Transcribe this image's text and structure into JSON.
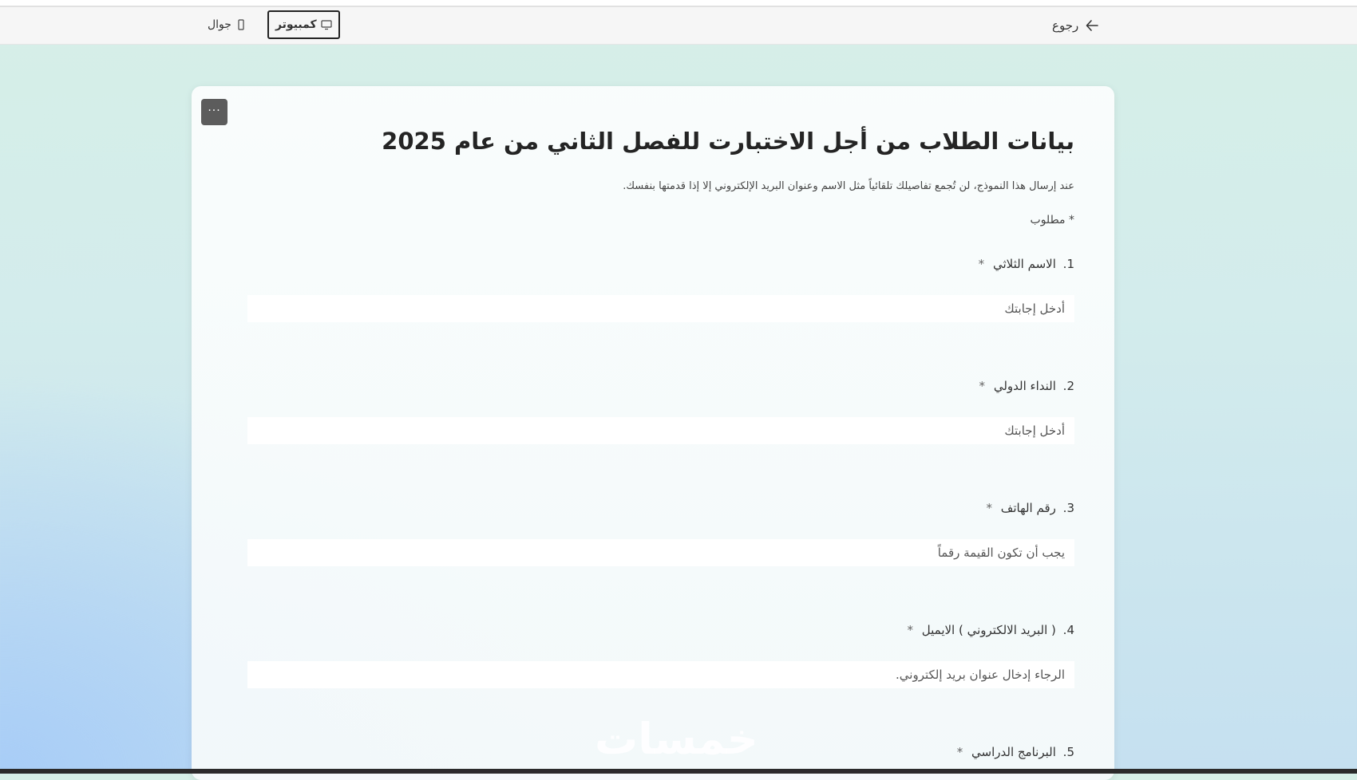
{
  "header": {
    "back_label": "رجوع",
    "view_desktop": "كمبيوتر",
    "view_mobile": "جوال"
  },
  "form": {
    "more_label": "···",
    "title": "بيانات الطلاب من أجل الاختبارت للفصل الثاني من عام 2025",
    "description": "عند إرسال هذا النموذج، لن تُجمع تفاصيلك تلقائياً مثل الاسم وعنوان البريد الإلكتروني إلا إذا قدمتها بنفسك.",
    "required_note": "* مطلوب",
    "questions": [
      {
        "number": "1.",
        "label": "الاسم الثلاثي",
        "required": "*",
        "placeholder": "أدخل إجابتك"
      },
      {
        "number": "2.",
        "label": "النداء الدولي",
        "required": "*",
        "placeholder": "أدخل إجابتك"
      },
      {
        "number": "3.",
        "label": "رقم الهاتف",
        "required": "*",
        "placeholder": "يجب أن تكون القيمة رقماً"
      },
      {
        "number": "4.",
        "label": "( البريد الالكتروني ) الايميل",
        "required": "*",
        "placeholder": "الرجاء إدخال عنوان بريد إلكتروني."
      },
      {
        "number": "5.",
        "label": "البرنامج الدراسي",
        "required": "*"
      }
    ]
  },
  "watermark": "خمسات",
  "colors": {
    "title": "#242424",
    "more_button_bg": "#5c5c5c",
    "background_top": "#d6efe7",
    "background_blue": "#a8cdf7"
  },
  "icons": {
    "back": "arrow-left-icon",
    "desktop": "monitor-icon",
    "mobile": "phone-icon"
  }
}
